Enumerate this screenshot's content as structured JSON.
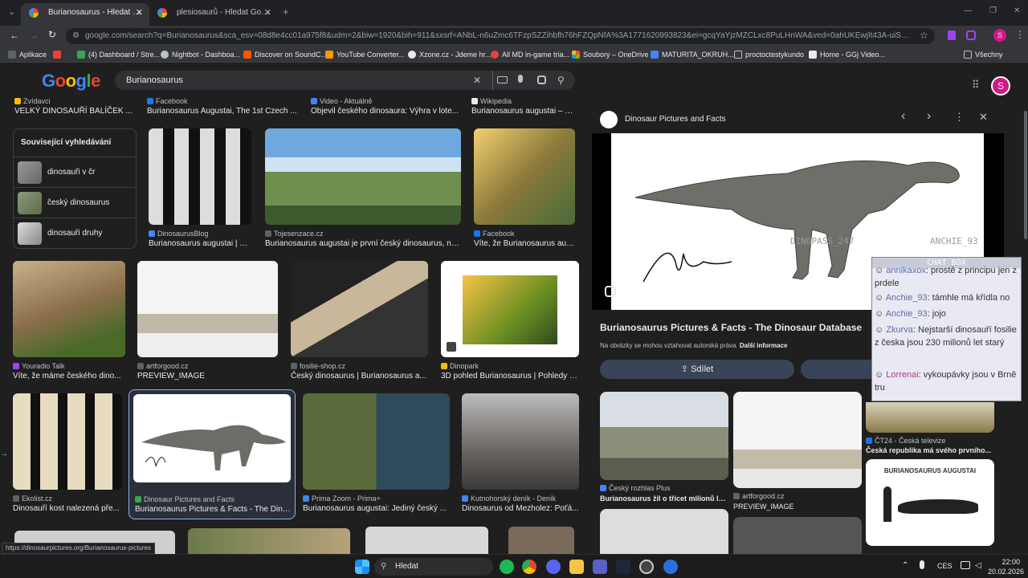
{
  "tabs": [
    {
      "title": "Burianosaurus - Hledat Google",
      "close": "✕"
    },
    {
      "title": "plesiosaurů - Hledat Googlem",
      "close": "✕"
    }
  ],
  "new_tab": "+",
  "window": {
    "min": "—",
    "max": "❐",
    "close": "✕",
    "dropdown": "⌄"
  },
  "url": "google.com/search?q=Burianosaurus&sca_esv=08d8e4cc01a975f8&udm=2&biw=1920&bih=911&sxsrf=ANbL-n6uZmc6TFzpSZZihbfh76hFZQpNfA%3A1771620993823&ei=gcqYaYjzMZCLxc8PuLHnWA&ved=0ahUKEwjIt43A-uiSAxWQRfEDHbjYGQs...",
  "bookmarks": [
    "Aplikace",
    "(4) Dashboard / Stre...",
    "Nightbot - Dashboa...",
    "Discover on SoundC...",
    "YouTube Converter...",
    "Xzone.cz - Jdeme hr...",
    "All MD in-game tria...",
    "Soubory – OneDrive",
    "MATURITA_OKRUH...",
    "proctoctestykundo",
    "Home - GGj Video...",
    "Všechny záložky"
  ],
  "google": {
    "logo": "Google",
    "query": "Burianosaurus",
    "avatar": "S"
  },
  "top_row": [
    {
      "src": "Zvídavci",
      "title": "VELKÝ DINOSAUŘÍ BALÍČEK ..."
    },
    {
      "src": "Facebook",
      "title": "Burianosaurus Augustai, The 1st Czech ..."
    },
    {
      "src": "Video - Aktuálně",
      "title": "Objevil českého dinosaura: Výhra v lote..."
    },
    {
      "src": "Wikipedia",
      "title": "Burianosaurus augustai – Wi..."
    }
  ],
  "related": {
    "heading": "Související vyhledávání",
    "items": [
      "dinosauři v čr",
      "český dinosaurus",
      "dinosauři druhy"
    ]
  },
  "row1": [
    {
      "src": "DinosaurusBlog",
      "title": "Burianosaurus augustai | D..."
    },
    {
      "src": "Tojesenzace.cz",
      "title": "Burianosaurus augustai je první český dinosaurus, naj..."
    },
    {
      "src": "Facebook",
      "title": "Víte, že Burianosaurus aug..."
    }
  ],
  "row2": [
    {
      "src": "Youradio Talk",
      "title": "Víte, že máme českého dino..."
    },
    {
      "src": "artforgood.cz",
      "title": "PREVIEW_IMAGE"
    },
    {
      "src": "fosilie-shop.cz",
      "title": "Český dinosaurus | Burianosaurus a..."
    },
    {
      "src": "Dinopark",
      "title": "3D pohled Burianosaurus | Pohledy a..."
    }
  ],
  "row3": [
    {
      "src": "Ekolist.cz",
      "title": "Dinosauří kost nalezená pře..."
    },
    {
      "src": "Dinosaur Pictures and Facts",
      "title": "Burianosaurus Pictures & Facts - The Dino..."
    },
    {
      "src": "Prima Zoom - Prima+",
      "title": "Burianosaurus augustai: Jediný český ..."
    },
    {
      "src": "Kutnohorský deník - Deník",
      "title": "Dinosaurus od Mezholez: Poťá..."
    }
  ],
  "panel": {
    "site": "Dinosaur Pictures and Facts",
    "title": "Burianosaurus Pictures & Facts - The Dinosaur Database",
    "copyright": "Na obrázky se mohou vztahovat autorská práva.",
    "more_info": "Další informace",
    "share": "Sdílet",
    "watermark1": "DINOPASS_247",
    "watermark2": "ANCHIE_93",
    "nav_prev": "‹",
    "nav_next": "›",
    "more": "⋮",
    "close": "✕",
    "related": [
      {
        "src": "Český rozhlas Plus",
        "title": "Burianosaurus žil o třicet milionů let..."
      },
      {
        "src": "artforgood.cz",
        "title": "PREVIEW_IMAGE"
      },
      {
        "src": "ČT24 - Česká televize",
        "title": "Česká republika má svého prvního..."
      }
    ],
    "skeleton_label": "BURIANOSAURUS AUGUSTAI"
  },
  "chatbox": {
    "title": "CHAT BOX",
    "lines": [
      {
        "user": "annikaxox",
        "text": ": prostě z principu jen z prdele"
      },
      {
        "user": "Anchie_93",
        "text": ": támhle má křídla no"
      },
      {
        "user": "Anchie_93",
        "text": ": jojo"
      },
      {
        "user": "Zkurva",
        "text": ": Nejstarší dinosauří fosilie z česka jsou 230 milionů let starý"
      },
      {
        "user": "Lorrenai",
        "text": ": vykoupávky jsou v Brně tru"
      }
    ]
  },
  "status_url": "https://dinosaurpictures.org/Burianosaurus-pictures",
  "taskbar": {
    "search": "Hledat",
    "lang": "CES",
    "time": "22:00",
    "date": "20.02.2026"
  },
  "colors": {
    "chat_user": "#5b6ea5",
    "chat_user2": "#b03a8f",
    "accent_blue": "#8ab4f8",
    "share_btn": "#394457"
  }
}
